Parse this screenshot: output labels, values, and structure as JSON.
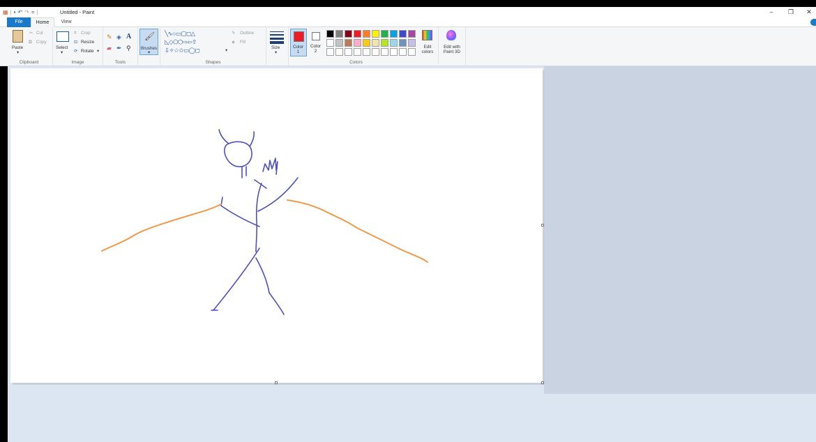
{
  "window": {
    "title": "Untitled - Paint",
    "controls": {
      "minimize": "–",
      "restore": "❐",
      "close": "✕"
    }
  },
  "quick_access": {
    "items": [
      "paint-icon",
      "save-icon",
      "undo-icon",
      "redo-icon",
      "customize-icon"
    ]
  },
  "tabs": [
    {
      "label": "File",
      "active": false
    },
    {
      "label": "Home",
      "active": true
    },
    {
      "label": "View",
      "active": false
    }
  ],
  "ribbon": {
    "clipboard": {
      "label": "Clipboard",
      "paste": "Paste",
      "cut": "Cut",
      "copy": "Copy"
    },
    "image": {
      "label": "Image",
      "select": "Select",
      "crop": "Crop",
      "resize": "Resize",
      "rotate": "Rotate"
    },
    "tools": {
      "label": "Tools"
    },
    "brushes": {
      "label": "Brushes"
    },
    "shapes": {
      "label": "Shapes",
      "outline": "Outline",
      "fill": "Fill"
    },
    "size": {
      "label": "Size"
    },
    "colors": {
      "label": "Colors",
      "color1_label": "Color\n1",
      "color1": "#ed1c24",
      "color2_label": "Color\n2",
      "color2": "#ffffff",
      "edit_colors": "Edit colors",
      "edit_paint3d": "Edit with Paint 3D",
      "palette_row1": [
        "#000000",
        "#7f7f7f",
        "#880015",
        "#ed1c24",
        "#ff7f27",
        "#fff200",
        "#22b14c",
        "#00a2e8",
        "#3f48cc",
        "#a349a4"
      ],
      "palette_row2": [
        "#ffffff",
        "#c3c3c3",
        "#b97a57",
        "#ffaec9",
        "#ffc90e",
        "#efe4b0",
        "#b5e61d",
        "#99d9ea",
        "#7092be",
        "#c8bfe7"
      ],
      "palette_row3": [
        "#ffffff",
        "#ffffff",
        "#ffffff",
        "#ffffff",
        "#ffffff",
        "#ffffff",
        "#ffffff",
        "#ffffff",
        "#ffffff",
        "#ffffff"
      ]
    }
  },
  "drawing": {
    "stroke_blue": "#4b4fc4",
    "stroke_orange": "#ef9a4a"
  }
}
